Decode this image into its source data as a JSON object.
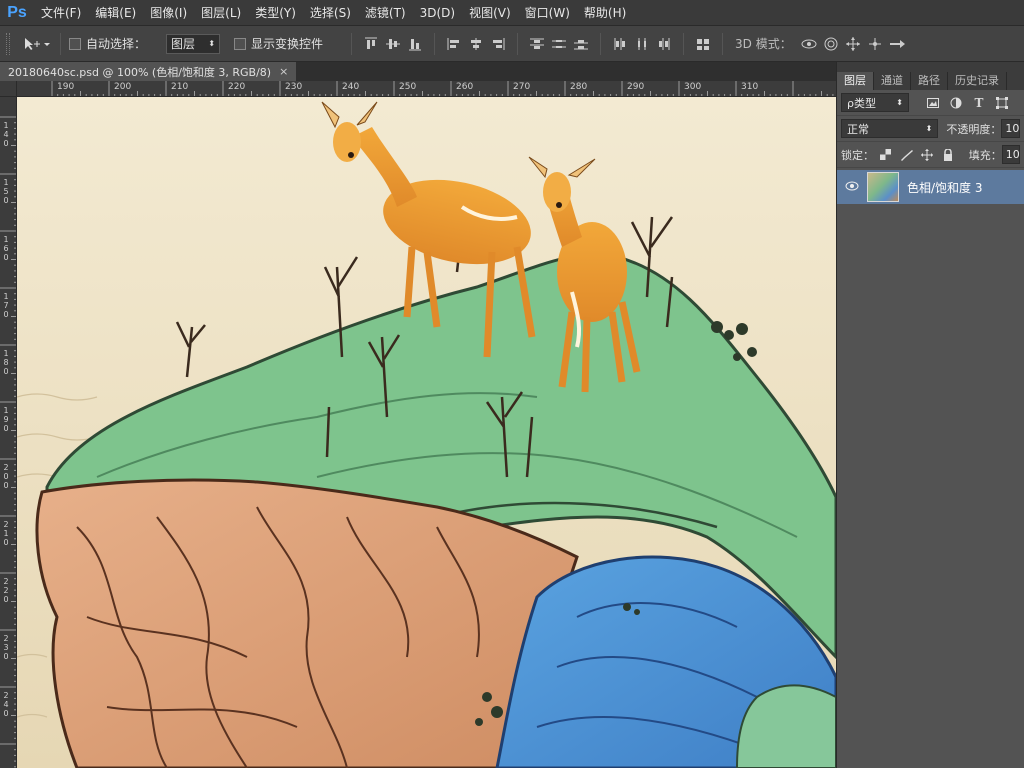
{
  "app": {
    "logo": "Ps"
  },
  "menu": [
    "文件(F)",
    "编辑(E)",
    "图像(I)",
    "图层(L)",
    "类型(Y)",
    "选择(S)",
    "滤镜(T)",
    "3D(D)",
    "视图(V)",
    "窗口(W)",
    "帮助(H)"
  ],
  "options": {
    "auto_select_label": "自动选择：",
    "auto_select_target": "图层",
    "show_transform_label": "显示变换控件",
    "mode_3d_label": "3D 模式："
  },
  "document": {
    "tab_title": "20180640sc.psd @ 100% (色相/饱和度 3, RGB/8)",
    "close_glyph": "×"
  },
  "rulers": {
    "horizontal": [
      "190",
      "200",
      "210",
      "220",
      "230",
      "240",
      "250",
      "260",
      "270",
      "280",
      "290",
      "300",
      "310"
    ],
    "vertical": [
      "140",
      "150",
      "160",
      "170",
      "180",
      "190",
      "200",
      "210",
      "220",
      "230",
      "240"
    ]
  },
  "panel": {
    "tabs": [
      "图层",
      "通道",
      "路径",
      "历史记录"
    ],
    "filter_kind": "ρ类型",
    "blend_mode": "正常",
    "opacity_label": "不透明度：",
    "opacity_value": "10",
    "lock_label": "锁定：",
    "fill_label": "填充：",
    "fill_value": "10",
    "layers": [
      {
        "name": "色相/饱和度 3",
        "visible": true,
        "selected": true
      }
    ]
  },
  "colors": {
    "accent": "#4aa3ff",
    "panel_bg": "#535353",
    "selected_layer": "#5d7a9e",
    "canvas_bg": "#efe4c8"
  }
}
